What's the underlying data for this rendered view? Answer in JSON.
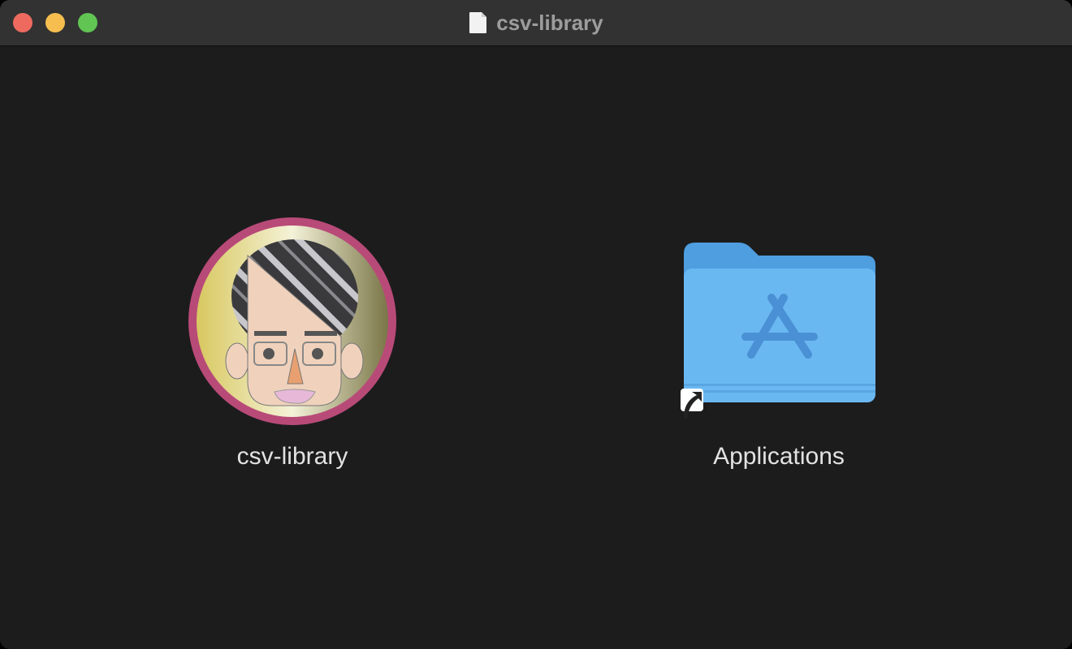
{
  "window": {
    "title": "csv-library",
    "title_icon": "document-icon"
  },
  "items": [
    {
      "label": "csv-library",
      "icon": "app-avatar-icon"
    },
    {
      "label": "Applications",
      "icon": "applications-folder-icon"
    }
  ],
  "colors": {
    "background": "#1c1c1c",
    "titlebar": "#323232",
    "folder": "#6ab8f2",
    "ring": "#b84a78"
  }
}
